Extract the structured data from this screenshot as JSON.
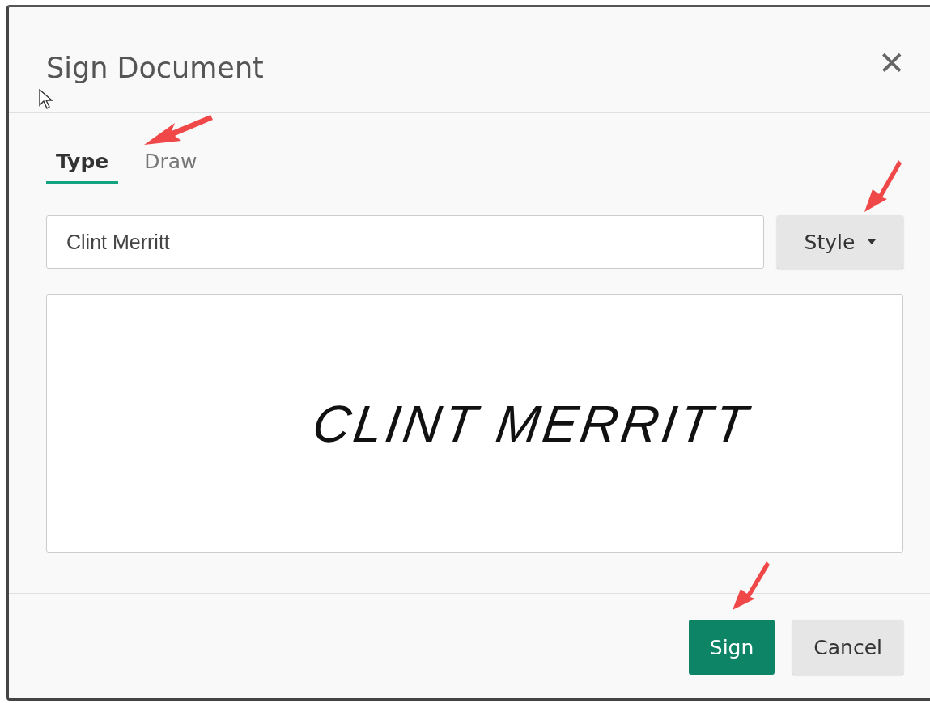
{
  "dialog": {
    "title": "Sign Document",
    "close": "✕"
  },
  "tabs": [
    {
      "label": "Type",
      "selected": true
    },
    {
      "label": "Draw",
      "selected": false
    }
  ],
  "name_field": {
    "value": "Clint Merritt"
  },
  "style_button": {
    "label": "Style"
  },
  "signature_preview": {
    "text": "CLINT MERRITT"
  },
  "buttons": [
    {
      "label": "Sign",
      "kind": "primary"
    },
    {
      "label": "Cancel",
      "kind": "secondary"
    }
  ]
}
